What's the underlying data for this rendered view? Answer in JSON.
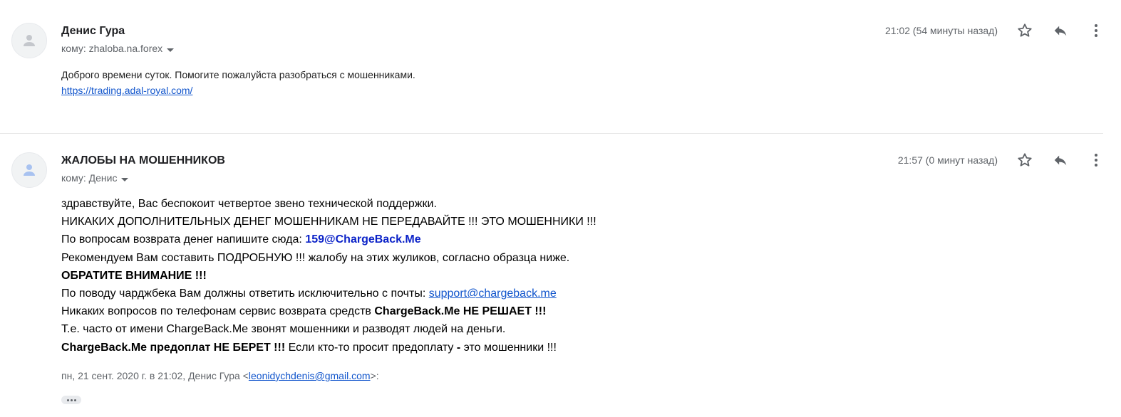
{
  "messages": [
    {
      "sender": "Денис Гура",
      "recipient": "кому: zhaloba.na.forex",
      "time": "21:02 (54 минуты назад)",
      "body": {
        "line1": "Доброго времени суток. Помогите пожалуйста разобраться с мошенниками.",
        "link": "https://trading.adal-royal.com/"
      }
    },
    {
      "sender": "ЖАЛОБЫ НА МОШЕННИКОВ",
      "recipient": "кому: Денис",
      "time": "21:57 (0 минут назад)",
      "body": {
        "l1": "здравствуйте, Вас беспокоит четвертое звено технической поддержки.",
        "l2": "НИКАКИХ ДОПОЛНИТЕЛЬНЫХ ДЕНЕГ МОШЕННИКАМ НЕ ПЕРЕДАВАЙТЕ !!! ЭТО МОШЕННИКИ !!!",
        "l3_text": "По вопросам возврата денег напишите сюда: ",
        "l3_email": "159@ChargeBack.Me",
        "l4": "Рекомендуем Вам составить ПОДРОБНУЮ !!! жалобу на этих жуликов, согласно образца ниже.",
        "l5": "ОБРАТИТЕ ВНИМАНИЕ !!!",
        "l6_text": "По поводу чарджбека Вам должны ответить исключительно с почты: ",
        "l6_link": "support@chargeback.me",
        "l7_text": "Никаких вопросов по телефонам сервис возврата средств ",
        "l7_bold": "ChargeBack.Me НЕ РЕШАЕТ !!!",
        "l8": "Т.е. часто от имени ChargeBack.Me звонят мошенники и разводят людей на деньги.",
        "l9_bold": "ChargeBack.Me предоплат НЕ БЕРЕТ !!!",
        "l9_text": " Если кто-то просит предоплату ",
        "l9_dash": "-",
        "l9_end": " это мошенники !!!"
      },
      "quote": {
        "prefix": "пн, 21 сент. 2020 г. в 21:02, Денис Гура <",
        "email": "leonidychdenis@gmail.com",
        "suffix": ">:"
      }
    }
  ],
  "icons": {
    "star": "star-icon",
    "reply": "reply-icon",
    "more": "more-vert-icon",
    "avatar": "person-icon",
    "expand": "ellipsis-icon"
  },
  "colors": {
    "link": "#1155cc",
    "email_highlight": "#0b22c8",
    "muted": "#5f6368"
  }
}
